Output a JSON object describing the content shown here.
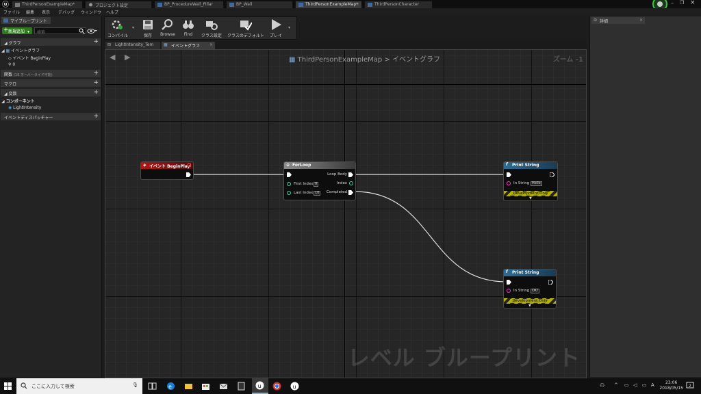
{
  "tabs": [
    {
      "label": "ThirdPersonExampleMap*",
      "active": false
    },
    {
      "label": "プロジェクト設定",
      "active": false
    },
    {
      "label": "BP_ProcedureWall_Pillar",
      "active": false
    },
    {
      "label": "BP_Wall",
      "active": false
    },
    {
      "label": "ThirdPersonExampleMap*",
      "active": true
    },
    {
      "label": "ThirdPersonCharacter",
      "active": false
    }
  ],
  "menu": [
    "ファイル",
    "編集",
    "表示",
    "デバッグ",
    "ウィンドウ",
    "ヘルプ"
  ],
  "left_panel": {
    "tab_label": "マイブループリント",
    "new_button": "新規追加",
    "search_placeholder": "検索",
    "graph_section": "グラフ",
    "event_graph": "イベントグラフ",
    "begin_play": "イベント BeginPlay",
    "zero_item": "0",
    "functions_section": "関数",
    "functions_note": "(19 オーバーライド可能)",
    "macros_section": "マクロ",
    "variables_section": "変数",
    "components_section": "コンポーネント",
    "component_item": "LightIntensity",
    "dispatchers_section": "イベントディスパッチャー"
  },
  "toolbar": {
    "compile": "コンパイル",
    "save": "保存",
    "browse": "Browse",
    "find": "Find",
    "class_settings": "クラス設定",
    "class_defaults": "クラスのデフォルト",
    "play": "プレイ"
  },
  "graph_tabs": [
    "LightIntensity_Tem",
    "イベントグラフ"
  ],
  "graph": {
    "breadcrumb_root": "ThirdPersonExampleMap",
    "breadcrumb_sep": ">",
    "breadcrumb_leaf": "イベントグラフ",
    "zoom": "ズーム -1",
    "watermark": "レベル ブループリント"
  },
  "nodes": {
    "begin_play": {
      "title": "イベント BeginPlay"
    },
    "for_loop": {
      "title": "ForLoop",
      "first_index_label": "First Index",
      "first_index_value": "0",
      "last_index_label": "Last Index",
      "last_index_value": "10",
      "loop_body": "Loop Body",
      "index": "Index",
      "completed": "Completed"
    },
    "print1": {
      "title": "Print String",
      "in_label": "In String",
      "in_value": "Hello",
      "dev": "Development Only"
    },
    "print2": {
      "title": "Print String",
      "in_label": "In String",
      "in_value": "OK!",
      "dev": "Development Only"
    }
  },
  "right_panel": {
    "tab_label": "詳細"
  },
  "taskbar": {
    "search_placeholder": "ここに入力して検索",
    "time": "23:06",
    "date": "2018/05/15"
  },
  "colors": {
    "event_red": "#a11414",
    "function_blue": "#2d6c96",
    "macro_grey": "#7a7a7a",
    "accent_green": "#2f7a1f"
  }
}
